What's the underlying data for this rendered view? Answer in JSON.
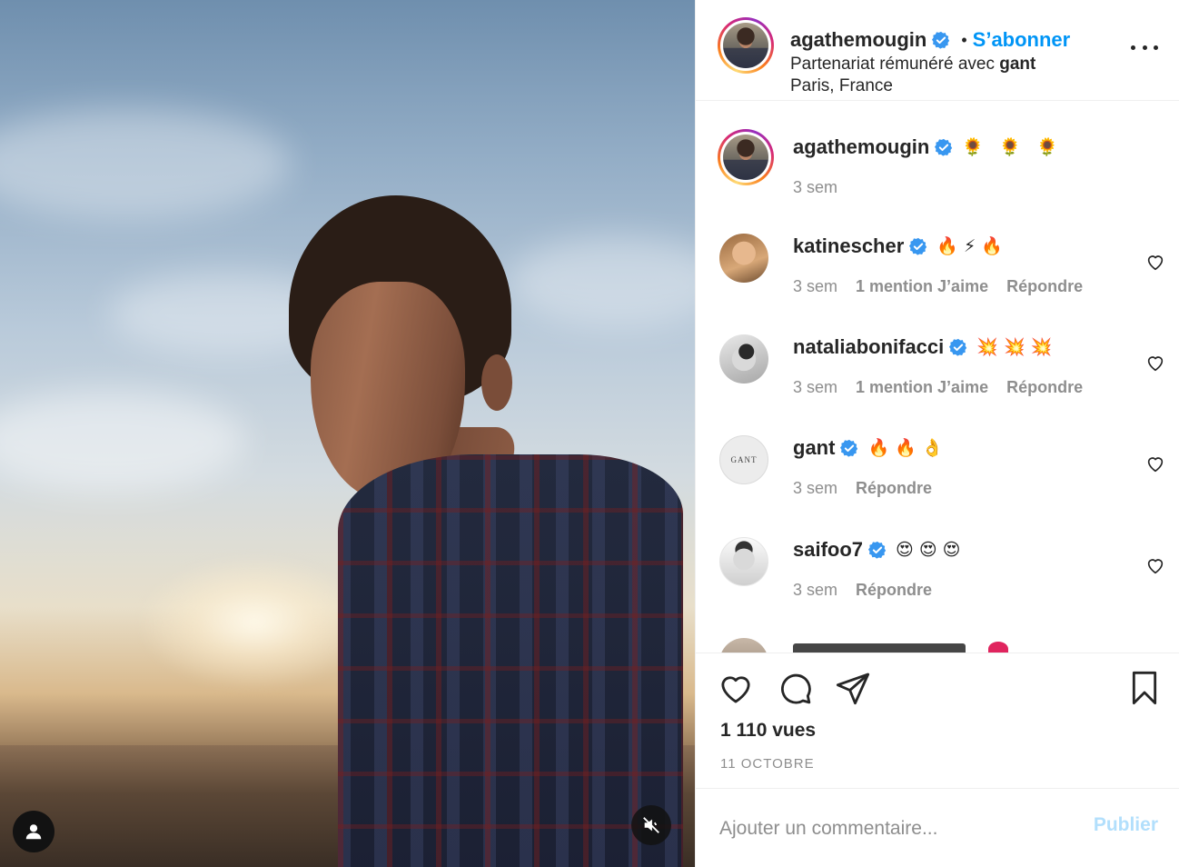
{
  "post": {
    "author": "agathemougin",
    "follow_label": "S’abonner",
    "separator": "•",
    "partnership_prefix": "Partenariat rémunéré avec ",
    "partnership_brand": "gant",
    "location": "Paris, France"
  },
  "caption": {
    "username": "agathemougin",
    "text": "🌻 🌻 🌻",
    "time": "3 sem"
  },
  "comments": [
    {
      "username": "katinescher",
      "text": "🔥⚡🔥",
      "time": "3 sem",
      "likes": "1 mention J’aime",
      "reply": "Répondre"
    },
    {
      "username": "nataliabonifacci",
      "text": "💥💥💥",
      "time": "3 sem",
      "likes": "1 mention J’aime",
      "reply": "Répondre"
    },
    {
      "username": "gant",
      "text": "🔥🔥👌",
      "time": "3 sem",
      "likes": "",
      "reply": "Répondre",
      "avatar_text": "GANT"
    },
    {
      "username": "saifoo7",
      "text": "😍😍😍",
      "time": "3 sem",
      "likes": "",
      "reply": "Répondre"
    }
  ],
  "stats": {
    "views": "1 110 vues",
    "date": "11 OCTOBRE"
  },
  "composer": {
    "placeholder": "Ajouter un commentaire...",
    "publish_label": "Publier"
  },
  "colors": {
    "accent": "#0095f6",
    "verified": "#3897f0",
    "muted": "#8e8e8e"
  },
  "icons": [
    "verified-badge-icon",
    "more-options-icon",
    "heart-icon",
    "comment-icon",
    "share-icon",
    "bookmark-icon",
    "user-tag-icon",
    "muted-speaker-icon"
  ]
}
